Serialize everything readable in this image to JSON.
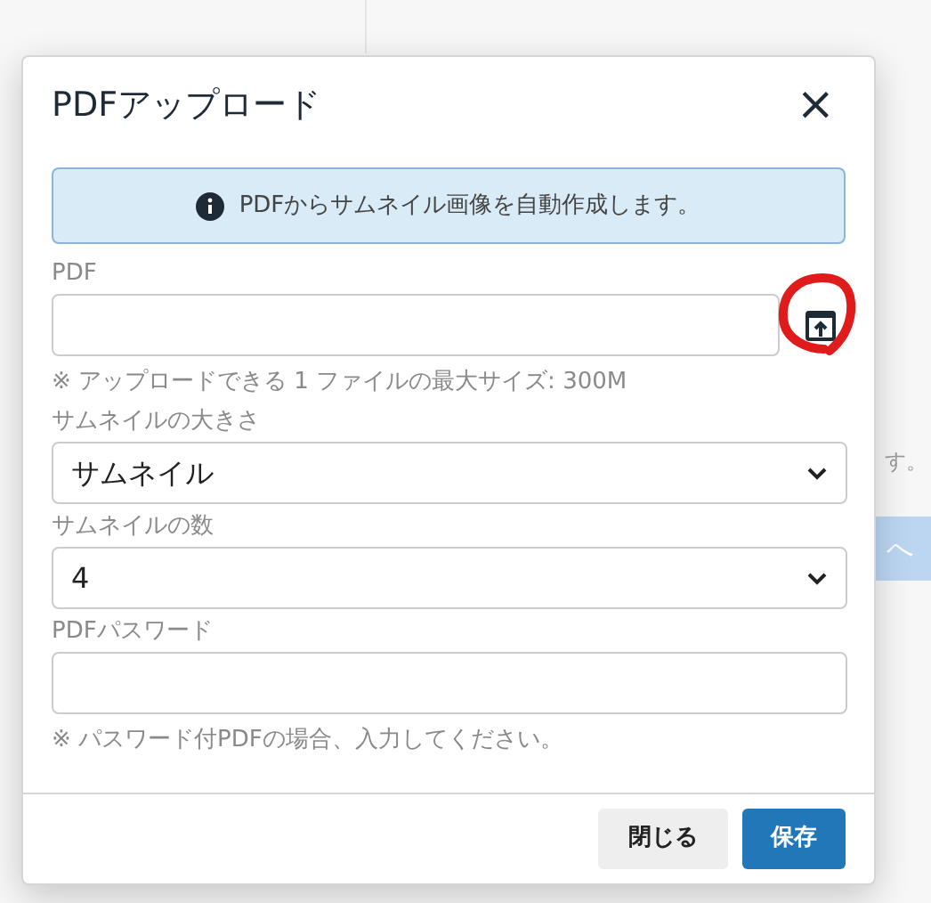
{
  "background": {
    "texts": [
      "す。"
    ],
    "button": "へ"
  },
  "dialog": {
    "title": "PDFアップロード",
    "close": "×",
    "alert": "PDFからサムネイル画像を自動作成します。",
    "fields": [
      {
        "kind": "file",
        "label": "PDF",
        "help": "※ アップロードできる 1 ファイルの最大サイズ: 300M"
      },
      {
        "kind": "select",
        "label": "サムネイルの大きさ",
        "value": "サムネイル"
      },
      {
        "kind": "select",
        "label": "サムネイルの数",
        "value": "4"
      },
      {
        "kind": "text",
        "label": "PDFパスワード",
        "help": "※ パスワード付PDFの場合、入力してください。"
      }
    ],
    "annotation": {
      "kind": "circle"
    },
    "buttons": [
      {
        "label": "閉じる",
        "kind": "secondary"
      },
      {
        "label": "保存",
        "kind": "primary"
      }
    ]
  }
}
